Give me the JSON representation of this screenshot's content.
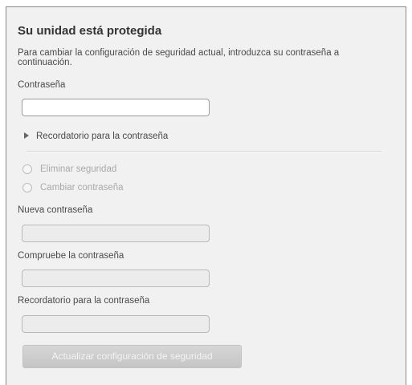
{
  "title": "Su unidad está protegida",
  "description": "Para cambiar la configuración de seguridad actual, introduzca su contraseña a continuación.",
  "current_password": {
    "label": "Contraseña",
    "value": ""
  },
  "hint_toggle": {
    "label": "Recordatorio para la contraseña",
    "icon": "triangle-right-icon",
    "expanded": false
  },
  "options": {
    "remove_security": {
      "label": "Eliminar seguridad",
      "checked": false,
      "enabled": false
    },
    "change_password": {
      "label": "Cambiar contraseña",
      "checked": false,
      "enabled": false
    }
  },
  "new_password": {
    "label": "Nueva contraseña",
    "value": ""
  },
  "confirm_password": {
    "label": "Compruebe la contraseña",
    "value": ""
  },
  "password_hint": {
    "label": "Recordatorio para la contraseña",
    "value": ""
  },
  "update_button": {
    "label": "Actualizar configuración de seguridad",
    "enabled": false
  },
  "colors": {
    "panel_background": "#f1f1f1",
    "text": "#4a4a4a",
    "disabled_text": "#a9a9a9",
    "button_background": "#cdcdcd"
  }
}
